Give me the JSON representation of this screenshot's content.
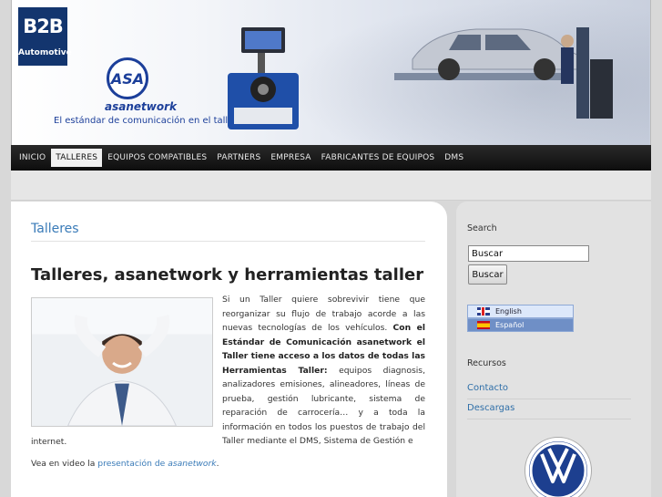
{
  "header": {
    "brand_big": "B2B",
    "brand_small": "Automotive",
    "logo_letters": "ASA",
    "logo_name": "asanetwork",
    "slogan": "El estándar de comunicación en el taller"
  },
  "nav": {
    "items": [
      {
        "label": "INICIO"
      },
      {
        "label": "TALLERES"
      },
      {
        "label": "EQUIPOS COMPATIBLES"
      },
      {
        "label": "PARTNERS"
      },
      {
        "label": "EMPRESA"
      },
      {
        "label": "FABRICANTES DE EQUIPOS"
      },
      {
        "label": "DMS"
      }
    ],
    "active": "TALLERES"
  },
  "main": {
    "section_title": "Talleres",
    "post_title": "Talleres, asanetwork y herramientas taller",
    "para_1": "Si un Taller quiere sobrevivir tiene que reorganizar su flujo de trabajo acorde a las nuevas tecnologías de los vehículos.",
    "para_bold": "Con el Estándar de Comunicación asanetwork el Taller tiene acceso a los datos de todas las Herramientas Taller:",
    "para_2": "equipos diagnosis, analizadores emisiones, alineadores, líneas de prueba, gestión lubricante, sistema de reparación de carrocería… y a toda la información en todos los puestos de trabajo del Taller mediante el DMS, Sistema de Gestión e",
    "para_tail": "internet.",
    "video_prefix": "Vea en video la ",
    "video_link": "presentación de ",
    "video_link_italic": "asanetwork",
    "video_suffix": "."
  },
  "sidebar": {
    "search_label": "Search",
    "search_value": "Buscar",
    "search_button": "Buscar",
    "languages": [
      {
        "label": "English"
      },
      {
        "label": "Español"
      }
    ],
    "resources_label": "Recursos",
    "links": [
      {
        "label": "Contacto"
      },
      {
        "label": "Descargas"
      }
    ]
  },
  "colors": {
    "accent": "#3a7bb8",
    "brand_navy": "#13356e",
    "nav_bg": "#111111"
  }
}
